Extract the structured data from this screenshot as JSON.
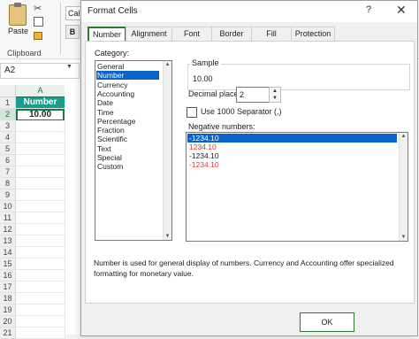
{
  "excel": {
    "paste_label": "Paste",
    "clipboard_label": "Clipboard",
    "font_box_value": "Calib",
    "bold_label": "B",
    "namebox_value": "A2",
    "column_header": "A",
    "rows": [
      "1",
      "2",
      "3",
      "4",
      "5",
      "6",
      "7",
      "8",
      "9",
      "10",
      "11",
      "12",
      "13",
      "14",
      "15",
      "16",
      "17",
      "18",
      "19",
      "20",
      "21"
    ],
    "a1_value": "Number",
    "a2_value": "10.00",
    "header_fill": "#1a9c8e"
  },
  "dialog": {
    "title": "Format Cells",
    "help_icon": "?",
    "close_icon": "✕",
    "tabs": [
      "Number",
      "Alignment",
      "Font",
      "Border",
      "Fill",
      "Protection"
    ],
    "active_tab": "Number",
    "category_label": "Category:",
    "categories": [
      "General",
      "Number",
      "Currency",
      "Accounting",
      "Date",
      "Time",
      "Percentage",
      "Fraction",
      "Scientific",
      "Text",
      "Special",
      "Custom"
    ],
    "selected_category": "Number",
    "sample_label": "Sample",
    "sample_value": "10.00",
    "decimal_label": "Decimal places:",
    "decimal_value": "2",
    "separator_label": "Use 1000 Separator (,)",
    "separator_checked": false,
    "negative_label": "Negative numbers:",
    "negative_numbers": [
      {
        "text": "-1234.10",
        "selected": true,
        "red": false
      },
      {
        "text": "1234.10",
        "selected": false,
        "red": true
      },
      {
        "text": "-1234.10",
        "selected": false,
        "red": false
      },
      {
        "text": "-1234.10",
        "selected": false,
        "red": true
      }
    ],
    "description": "Number is used for general display of numbers. Currency and Accounting offer specialized formatting for monetary value.",
    "ok_label": "OK",
    "cancel_label": "Cancel",
    "accent_color": "#2a7d2a",
    "selection_color": "#0a63c9",
    "negative_red": "#e53935"
  }
}
